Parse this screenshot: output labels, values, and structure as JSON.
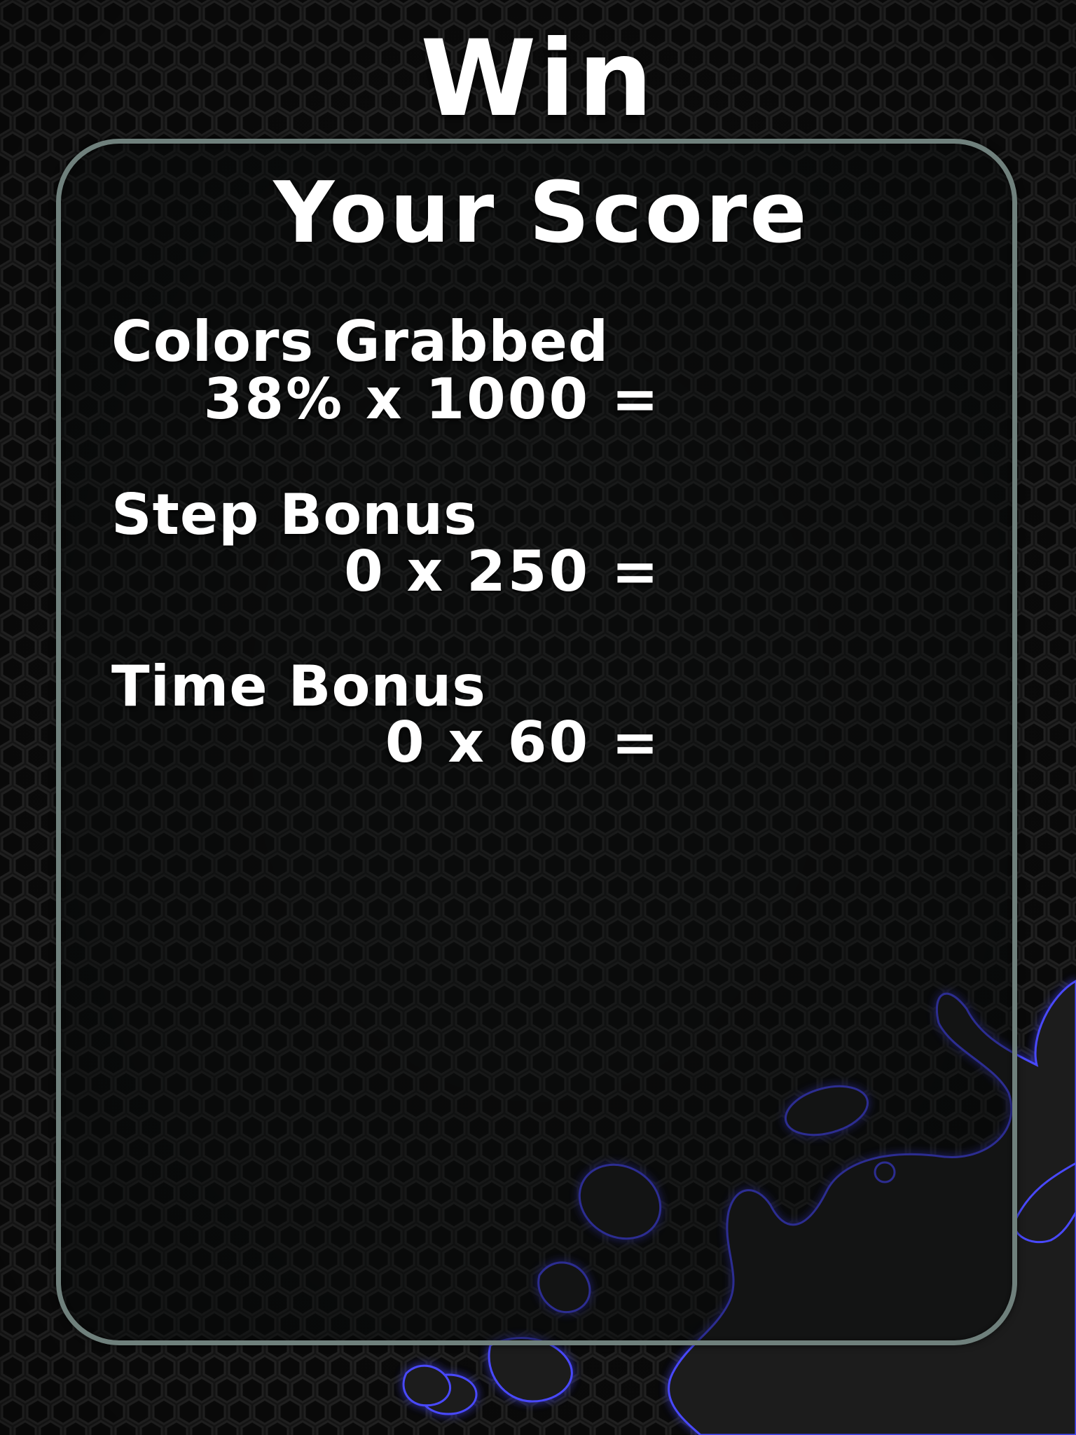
{
  "screen": {
    "result_title": "Win"
  },
  "score_panel": {
    "title": "Your Score",
    "rows": [
      {
        "label": "Colors Grabbed",
        "formula": "38% x 1000 ="
      },
      {
        "label": "Step Bonus",
        "formula": "0 x 250 ="
      },
      {
        "label": "Time Bonus",
        "formula": "0 x 60 ="
      }
    ]
  },
  "colors": {
    "background": "#151515",
    "panel_border": "#6f807c",
    "text": "#ffffff",
    "splat_glow": "#4a48ff"
  }
}
